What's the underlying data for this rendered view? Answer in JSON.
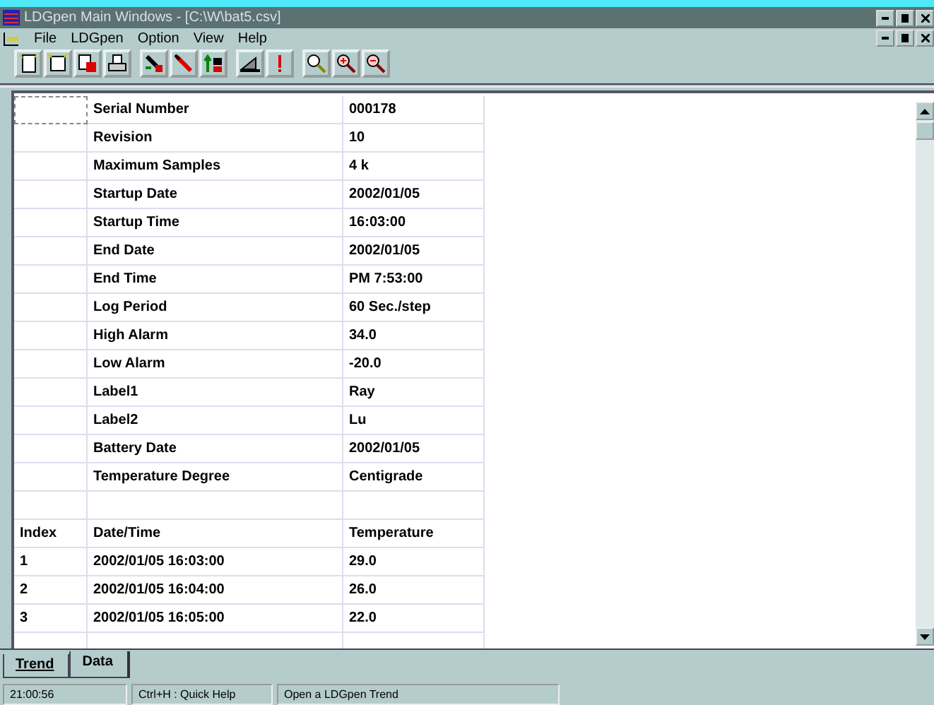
{
  "window": {
    "title": "LDGpen Main Windows - [C:\\W\\bat5.csv]"
  },
  "menu": [
    "File",
    "LDGpen",
    "Option",
    "View",
    "Help"
  ],
  "toolbar": [
    [
      {
        "kind": "new"
      },
      {
        "kind": "open"
      },
      {
        "kind": "save"
      },
      {
        "kind": "print"
      }
    ],
    [
      {
        "kind": "download"
      },
      {
        "kind": "probe"
      },
      {
        "kind": "upload"
      }
    ],
    [
      {
        "kind": "stop"
      },
      {
        "kind": "alarm"
      }
    ],
    [
      {
        "kind": "zoom"
      },
      {
        "kind": "zoom-in"
      },
      {
        "kind": "zoom-out"
      }
    ]
  ],
  "info_rows": [
    {
      "label": "Serial Number",
      "value": "000178"
    },
    {
      "label": "Revision",
      "value": "10"
    },
    {
      "label": "Maximum Samples",
      "value": "4 k"
    },
    {
      "label": "Startup Date",
      "value": "2002/01/05"
    },
    {
      "label": "Startup Time",
      "value": "16:03:00"
    },
    {
      "label": "End Date",
      "value": "2002/01/05"
    },
    {
      "label": "End Time",
      "value": "PM 7:53:00"
    },
    {
      "label": "Log Period",
      "value": "60 Sec./step"
    },
    {
      "label": "High Alarm",
      "value": "34.0"
    },
    {
      "label": "Low Alarm",
      "value": "-20.0"
    },
    {
      "label": "Label1",
      "value": "Ray"
    },
    {
      "label": "Label2",
      "value": "Lu"
    },
    {
      "label": "Battery Date",
      "value": "2002/01/05"
    },
    {
      "label": "Temperature Degree",
      "value": "Centigrade"
    }
  ],
  "data_table": {
    "columns": [
      "Index",
      "Date/Time",
      "Temperature"
    ],
    "rows": [
      [
        "1",
        "2002/01/05 16:03:00",
        "29.0"
      ],
      [
        "2",
        "2002/01/05 16:04:00",
        "26.0"
      ],
      [
        "3",
        "2002/01/05 16:05:00",
        "22.0"
      ]
    ]
  },
  "tabs": [
    {
      "label": "Trend",
      "selected": false
    },
    {
      "label": "Data",
      "selected": true
    }
  ],
  "status_bar": [
    "21:00:56",
    "Ctrl+H : Quick Help",
    "Open a LDGpen Trend"
  ]
}
